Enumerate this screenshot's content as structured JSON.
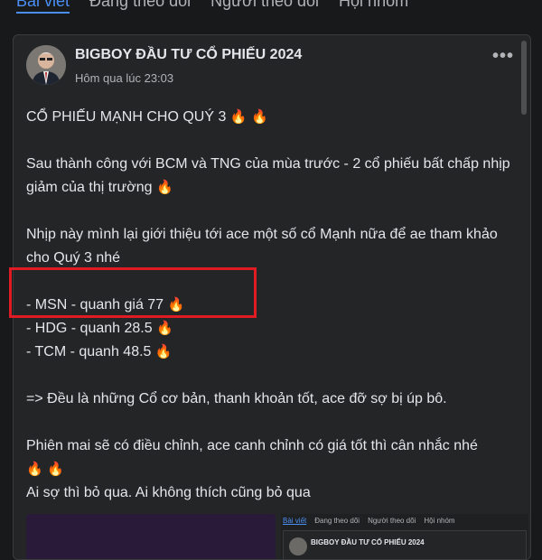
{
  "tabs": [
    {
      "label": "Bài viết",
      "active": true
    },
    {
      "label": "Đang theo dõi"
    },
    {
      "label": "Người theo dõi"
    },
    {
      "label": "Hội nhóm"
    }
  ],
  "post": {
    "author": "BIGBOY ĐẦU TƯ CỔ PHIẾU 2024",
    "time": "Hôm qua lúc 23:03",
    "more": "•••",
    "lines": {
      "l1": "CỔ PHIẾU MẠNH CHO QUÝ 3",
      "l2": "Sau thành công với BCM và TNG của mùa trước - 2 cổ phiếu bất chấp nhịp giảm của thị trường",
      "l3": "Nhịp này mình lại giới thiệu tới ace một số cổ Mạnh nữa để ae tham khảo cho Quý 3 nhé",
      "s1": "- MSN - quanh giá 77",
      "s2": "- HDG - quanh 28.5",
      "s3": "- TCM - quanh 48.5",
      "l4": "=> Đều là những Cổ cơ bản, thanh khoản tốt, ace đỡ sợ bị úp bô.",
      "l5": "Phiên mai sẽ có điều chỉnh, ace canh chỉnh có giá tốt thì cân nhắc nhé",
      "l6": "Ai sợ thì bỏ qua. Ai không thích cũng bỏ qua"
    },
    "fire": "🔥"
  },
  "preview": {
    "tabs": [
      "Bài viết",
      "Đang theo dõi",
      "Người theo dõi",
      "Hội nhóm"
    ],
    "author": "BIGBOY ĐẦU TƯ CỔ PHIẾU 2024"
  },
  "colors": {
    "background": "#18191a",
    "card": "#242526",
    "accent": "#4a8ff5",
    "highlight": "#e01b24"
  }
}
